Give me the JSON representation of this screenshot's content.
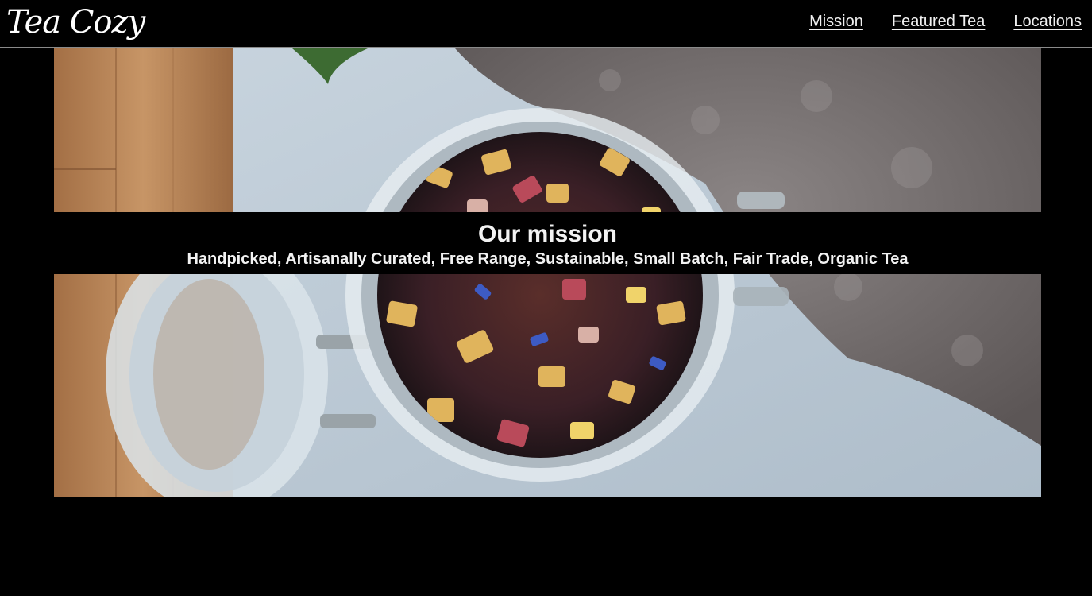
{
  "header": {
    "logo": "Tea Cozy",
    "nav": [
      {
        "label": "Mission"
      },
      {
        "label": "Featured Tea"
      },
      {
        "label": "Locations"
      }
    ]
  },
  "hero": {
    "title": "Our mission",
    "subtitle": "Handpicked, Artisanally Curated, Free Range, Sustainable, Small Batch, Fair Trade, Organic Tea",
    "image_subject": "open glass jar of loose-leaf herbal tea on a wooden board beside a gray knit blanket"
  },
  "colors": {
    "background": "#000000",
    "text": "#ffffff",
    "header_border": "#8a8a8a"
  }
}
